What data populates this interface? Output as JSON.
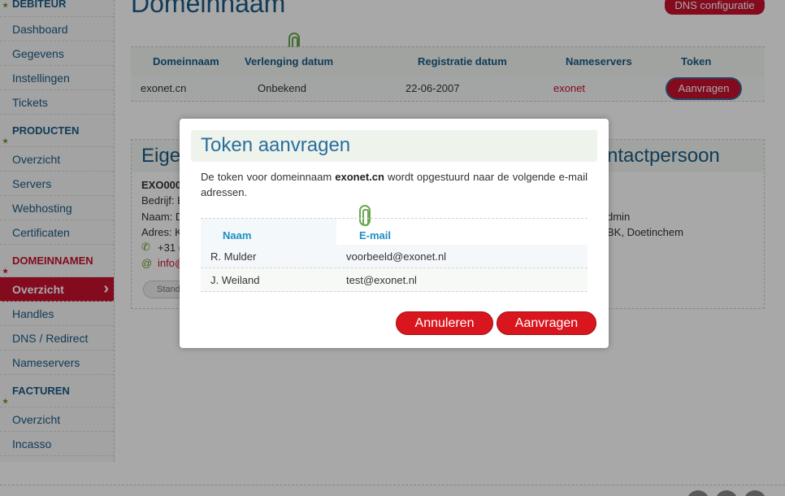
{
  "sidebar": {
    "sections": [
      {
        "title": "DEBITEUR",
        "items": [
          "Dashboard",
          "Gegevens",
          "Instellingen",
          "Tickets"
        ]
      },
      {
        "title": "PRODUCTEN",
        "items": [
          "Overzicht",
          "Servers",
          "Webhosting",
          "Certificaten"
        ]
      },
      {
        "title": "DOMEINNAMEN",
        "items": [
          "Overzicht",
          "Handles",
          "DNS / Redirect",
          "Nameservers"
        ]
      },
      {
        "title": "FACTUREN",
        "items": [
          "Overzicht",
          "Incasso"
        ]
      }
    ]
  },
  "page": {
    "title": "Domeinnaam",
    "dns_button": "DNS configuratie"
  },
  "domain_table": {
    "headers": [
      "Domeinnaam",
      "Verlenging datum",
      "Registratie datum",
      "Nameservers",
      "Token"
    ],
    "row": {
      "domain": "exonet.cn",
      "renewal": "Onbekend",
      "registration": "22-06-2007",
      "nameservers": "exonet",
      "token_button": "Aanvragen"
    }
  },
  "owner_panel": {
    "title_left": "Eige",
    "title_right": "ntactpersoon",
    "lines_left": [
      "EXO000",
      "Bedrijf: E",
      "Naam: D",
      "Adres: K",
      "+31 (0",
      "info@"
    ],
    "lines_right": [
      "dmin",
      "BK, Doetinchem"
    ],
    "stand_label": "Stand"
  },
  "modal": {
    "title": "Token aanvragen",
    "text_before": "De token voor domeinnaam ",
    "domain": "exonet.cn",
    "text_after": " wordt opgestuurd naar de volgende e-mail adressen.",
    "headers": {
      "name": "Naam",
      "email": "E-mail"
    },
    "rows": [
      {
        "name": "R. Mulder",
        "email": "voorbeeld@exonet.nl"
      },
      {
        "name": "J. Weiland",
        "email": "test@exonet.nl"
      }
    ],
    "cancel_label": "Annuleren",
    "submit_label": "Aanvragen"
  }
}
